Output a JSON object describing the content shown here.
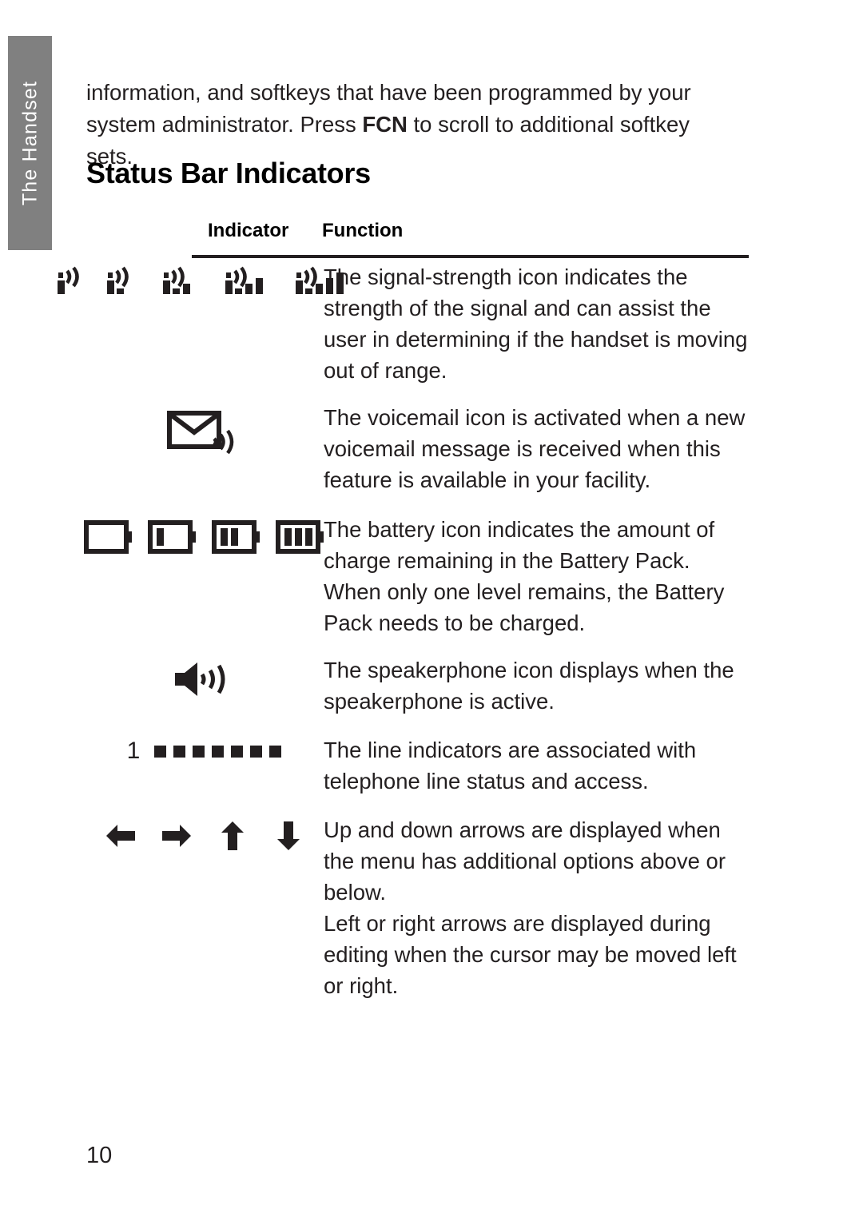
{
  "side_tab": {
    "label": "The Handset"
  },
  "intro": {
    "text_before": "information, and softkeys that have been programmed by your system administrator. Press ",
    "emphasis": "FCN",
    "text_after": " to scroll to additional softkey sets."
  },
  "section_title": "Status Bar Indicators",
  "table": {
    "headers": {
      "indicator": "Indicator",
      "function": "Function"
    },
    "rows": [
      {
        "icon_name": "signal-strength-icons",
        "icon_variants": [
          "signal-0-bars",
          "signal-1-bar",
          "signal-2-bars",
          "signal-3-bars",
          "signal-4-bars"
        ],
        "description": "The signal-strength icon indicates the strength of the signal and can assist the user in determining if the handset is moving out of range."
      },
      {
        "icon_name": "voicemail-icon",
        "icon_variants": [
          "envelope-with-waves"
        ],
        "description": "The voicemail icon is activated when a new voicemail message is received when this feature is available in your facility."
      },
      {
        "icon_name": "battery-icons",
        "icon_variants": [
          "battery-0-bars",
          "battery-1-bar",
          "battery-2-bars",
          "battery-3-bars"
        ],
        "description": "The battery icon indicates the amount of charge remaining in the Battery Pack. When only one level remains, the Battery Pack needs to be charged."
      },
      {
        "icon_name": "speakerphone-icon",
        "icon_variants": [
          "speaker-with-waves"
        ],
        "description": "The speakerphone icon displays when the speakerphone is active."
      },
      {
        "icon_name": "line-indicator-icons",
        "line_number": "1",
        "square_count": 7,
        "description": "The line indicators are associated with telephone line status and access."
      },
      {
        "icon_name": "arrow-icons",
        "icon_variants": [
          "arrow-left",
          "arrow-right",
          "arrow-up",
          "arrow-down"
        ],
        "description_1": "Up and down arrows are displayed when the menu has additional options above or below.",
        "description_2": "Left or right arrows are displayed during editing when the cursor may be moved left or right."
      }
    ]
  },
  "page_number": "10",
  "colors": {
    "side_tab_background": "#808080",
    "side_tab_text": "#ffffff",
    "body_text": "#231f20",
    "rule": "#231f20"
  }
}
